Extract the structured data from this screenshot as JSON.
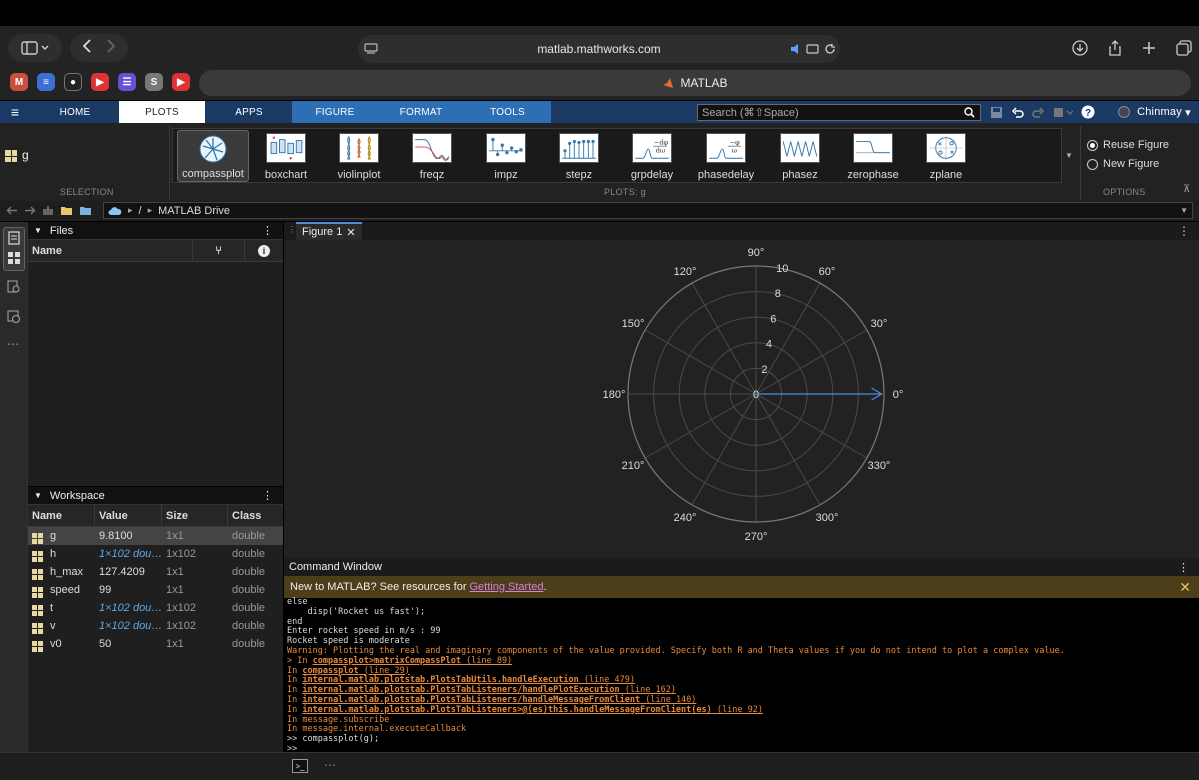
{
  "browser": {
    "url": "matlab.mathworks.com",
    "tab_title": "MATLAB"
  },
  "menubar": {
    "tabs": [
      "HOME",
      "PLOTS",
      "APPS",
      "FIGURE",
      "FORMAT",
      "TOOLS"
    ],
    "search_placeholder": "Search (⌘⇧Space)",
    "user": "Chinmay"
  },
  "ribbon": {
    "selection_var": "g",
    "selection_label": "SELECTION",
    "gallery": [
      "compassplot",
      "boxchart",
      "violinplot",
      "freqz",
      "impz",
      "stepz",
      "grpdelay",
      "phasedelay",
      "phasez",
      "zerophase",
      "zplane"
    ],
    "plots_label": "PLOTS: g",
    "options": [
      "Reuse Figure",
      "New Figure"
    ],
    "options_label": "OPTIONS"
  },
  "address": {
    "root": "/",
    "folder": "MATLAB Drive"
  },
  "files": {
    "title": "Files",
    "col_name": "Name"
  },
  "workspace": {
    "title": "Workspace",
    "columns": [
      "Name",
      "Value",
      "Size",
      "Class"
    ],
    "rows": [
      {
        "name": "g",
        "value": "9.8100",
        "size": "1x1",
        "class": "double"
      },
      {
        "name": "h",
        "value": "1×102 dou…",
        "size": "1x102",
        "class": "double"
      },
      {
        "name": "h_max",
        "value": "127.4209",
        "size": "1x1",
        "class": "double"
      },
      {
        "name": "speed",
        "value": "99",
        "size": "1x1",
        "class": "double"
      },
      {
        "name": "t",
        "value": "1×102 dou…",
        "size": "1x102",
        "class": "double"
      },
      {
        "name": "v",
        "value": "1×102 dou…",
        "size": "1x102",
        "class": "double"
      },
      {
        "name": "v0",
        "value": "50",
        "size": "1x1",
        "class": "double"
      }
    ]
  },
  "figure": {
    "tab_title": "Figure 1",
    "angle_labels": [
      "0°",
      "30°",
      "60°",
      "90°",
      "120°",
      "150°",
      "180°",
      "210°",
      "240°",
      "270°",
      "300°",
      "330°"
    ],
    "radial_labels": [
      "0",
      "2",
      "4",
      "6",
      "8",
      "10"
    ],
    "arrow_color": "#4a90d9"
  },
  "chart_data": {
    "type": "compass",
    "angles_deg": [
      0,
      30,
      60,
      90,
      120,
      150,
      180,
      210,
      240,
      270,
      300,
      330
    ],
    "rlim": [
      0,
      10
    ],
    "rticks": [
      0,
      2,
      4,
      6,
      8,
      10
    ],
    "vectors": [
      {
        "theta_deg": 0,
        "r": 9.81
      }
    ],
    "grid": true
  },
  "command": {
    "title": "Command Window",
    "banner_text": "New to MATLAB? See resources for ",
    "banner_link": "Getting Started",
    "banner_end": ".",
    "lines": [
      {
        "t": "else",
        "c": "n"
      },
      {
        "t": "    disp('Rocket us fast');",
        "c": "n"
      },
      {
        "t": "end",
        "c": "n"
      },
      {
        "t": "Enter rocket speed in m/s : 99",
        "c": "n"
      },
      {
        "t": "Rocket speed is moderate",
        "c": "n"
      },
      {
        "t": "Warning: Plotting the real and imaginary components of the value provided. Specify both R and Theta values if you do not intend to plot a complex value.",
        "c": "o"
      },
      {
        "t": "> In ",
        "c": "o",
        "link": "compassplot>matrixCompassPlot",
        "tail": " (line 89)"
      },
      {
        "t": "In ",
        "c": "o",
        "link": "compassplot",
        "tail": " (line 29)"
      },
      {
        "t": "In ",
        "c": "o",
        "link": "internal.matlab.plotstab.PlotsTabUtils.handleExecution",
        "tail": " (line 479)"
      },
      {
        "t": "In ",
        "c": "o",
        "link": "internal.matlab.plotstab.PlotsTabListeners/handlePlotExecution",
        "tail": " (line 162)"
      },
      {
        "t": "In ",
        "c": "o",
        "link": "internal.matlab.plotstab.PlotsTabListeners/handleMessageFromClient",
        "tail": " (line 140)"
      },
      {
        "t": "In ",
        "c": "o",
        "link": "internal.matlab.plotstab.PlotsTabListeners>@(es)this.handleMessageFromClient(es)",
        "tail": " (line 92)"
      },
      {
        "t": "In message.subscribe",
        "c": "o"
      },
      {
        "t": "In message.internal.executeCallback",
        "c": "o"
      },
      {
        "t": ">> compassplot(g);",
        "c": "n"
      },
      {
        "t": ">>",
        "c": "n"
      }
    ]
  }
}
